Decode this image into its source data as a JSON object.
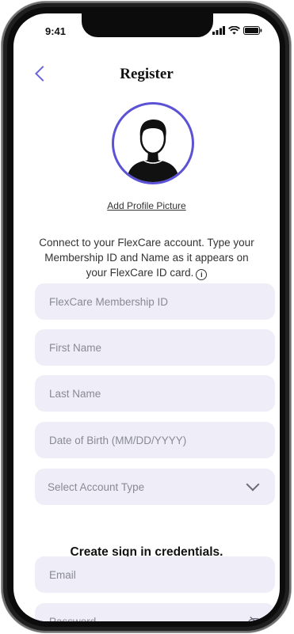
{
  "status": {
    "time": "9:41"
  },
  "header": {
    "title": "Register"
  },
  "profile": {
    "add_picture_label": "Add Profile Picture"
  },
  "intro": {
    "text": "Connect to your FlexCare account. Type your Membership ID and Name as it appears on your FlexCare ID card."
  },
  "form": {
    "membership_id_placeholder": "FlexCare Membership ID",
    "first_name_placeholder": "First Name",
    "last_name_placeholder": "Last Name",
    "dob_placeholder": "Date of Birth (MM/DD/YYYY)",
    "account_type_placeholder": "Select Account Type"
  },
  "credentials": {
    "title": "Create sign in credentials.",
    "email_placeholder": "Email",
    "password_placeholder": "Password"
  },
  "icons": [
    "back-chevron-icon",
    "info-icon",
    "chevron-down-icon",
    "eye-slash-icon",
    "signal-icon",
    "wifi-icon",
    "battery-icon"
  ],
  "colors": {
    "accent": "#5b52d6",
    "field_bg": "#eeedf8"
  }
}
